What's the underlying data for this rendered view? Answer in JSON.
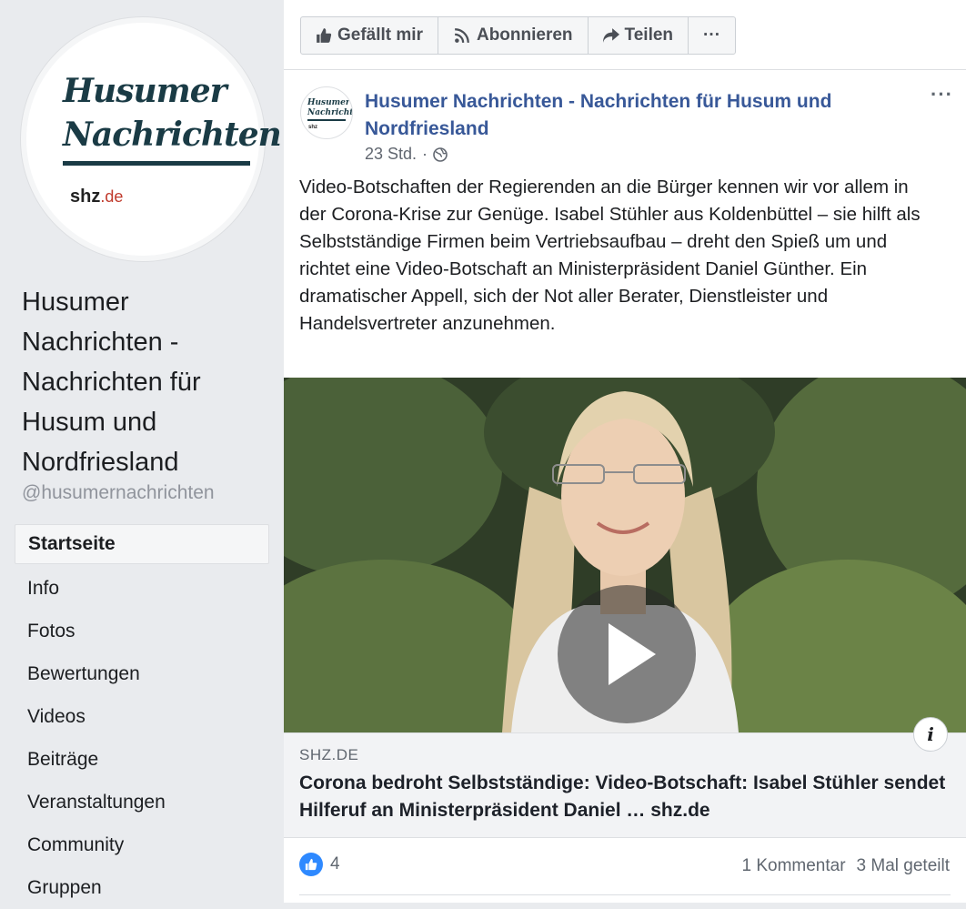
{
  "page": {
    "logo": {
      "line1": "Husumer",
      "line2": "Nachrichten",
      "brand": "shz",
      "brand_tld": ".de"
    },
    "title": "Husumer Nachrichten - Nachrichten für Husum und Nordfriesland",
    "handle": "@husumernachrichten"
  },
  "sidebar": {
    "items": [
      {
        "label": "Startseite",
        "active": true
      },
      {
        "label": "Info"
      },
      {
        "label": "Fotos"
      },
      {
        "label": "Bewertungen"
      },
      {
        "label": "Videos"
      },
      {
        "label": "Beiträge"
      },
      {
        "label": "Veranstaltungen"
      },
      {
        "label": "Community"
      },
      {
        "label": "Gruppen"
      }
    ]
  },
  "actions": {
    "like": "Gefällt mir",
    "follow": "Abonnieren",
    "share": "Teilen",
    "more": "···"
  },
  "post": {
    "author": "Husumer Nachrichten - Nachrichten für Husum und Nordfriesland",
    "time": "23 Std.",
    "separator": "·",
    "menu": "···",
    "text": "Video-Botschaften der Regierenden an die Bürger kennen wir vor allem in der Corona-Krise zur Genüge. Isabel Stühler aus Koldenbüttel – sie hilft als Selbstständige Firmen beim Vertriebsaufbau – dreht den Spieß um und richtet eine Video-Botschaft an Ministerpräsident Daniel Günther. Ein dramatischer Appell, sich der Not aller Berater, Dienstleister und Handelsvertreter anzunehmen.",
    "link": {
      "domain": "SHZ.DE",
      "title": "Corona bedroht Selbstständige: Video-Botschaft: Isabel Stühler sendet Hilferuf an Ministerpräsident Daniel … shz.de",
      "info": "i"
    },
    "reactions": {
      "count": "4"
    },
    "comments": "1 Kommentar",
    "shares": "3 Mal geteilt"
  },
  "colors": {
    "link_blue": "#385898",
    "like_blue": "#2e89ff",
    "bg": "#e9ebee"
  },
  "icons": [
    "thumbs-up-icon",
    "rss-icon",
    "share-arrow-icon",
    "globe-icon",
    "play-icon",
    "info-icon"
  ]
}
